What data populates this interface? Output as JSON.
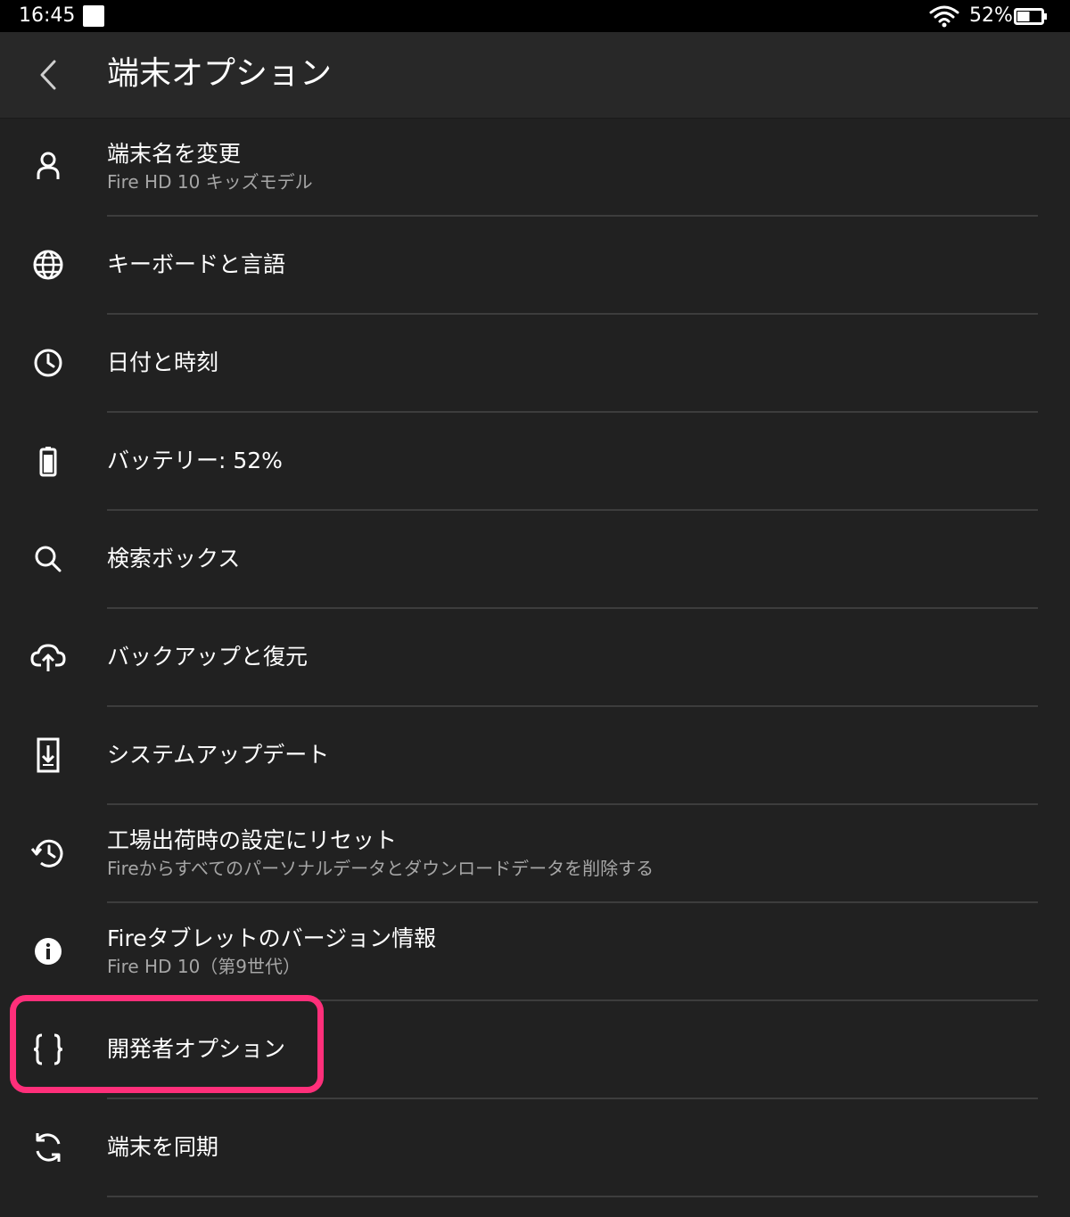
{
  "status_bar": {
    "time": "16:45",
    "notification_icon": "notification-square-icon",
    "wifi_icon": "wifi-icon",
    "battery_text": "52%",
    "battery_icon": "battery-icon",
    "battery_level": 0.52
  },
  "app_bar": {
    "back_icon": "chevron-left-icon",
    "title": "端末オプション"
  },
  "settings": [
    {
      "icon": "person-icon",
      "title": "端末名を変更",
      "subtitle": "Fire HD 10 キッズモデル"
    },
    {
      "icon": "globe-icon",
      "title": "キーボードと言語",
      "subtitle": ""
    },
    {
      "icon": "clock-icon",
      "title": "日付と時刻",
      "subtitle": ""
    },
    {
      "icon": "battery-icon",
      "title": "バッテリー: 52%",
      "subtitle": ""
    },
    {
      "icon": "search-icon",
      "title": "検索ボックス",
      "subtitle": ""
    },
    {
      "icon": "cloud-upload-icon",
      "title": "バックアップと復元",
      "subtitle": ""
    },
    {
      "icon": "system-update-icon",
      "title": "システムアップデート",
      "subtitle": ""
    },
    {
      "icon": "restore-icon",
      "title": "工場出荷時の設定にリセット",
      "subtitle": "Fireからすべてのパーソナルデータとダウンロードデータを削除する"
    },
    {
      "icon": "info-icon",
      "title": "Fireタブレットのバージョン情報",
      "subtitle": "Fire HD 10（第9世代）"
    },
    {
      "icon": "braces-icon",
      "title": "開発者オプション",
      "subtitle": ""
    },
    {
      "icon": "sync-icon",
      "title": "端末を同期",
      "subtitle": ""
    }
  ],
  "highlight": {
    "target": "開発者オプション",
    "color": "#ff2f7a"
  },
  "colors": {
    "background": "#212121",
    "app_bar": "#282828",
    "status_bar": "#000000",
    "divider": "#3d3d3d",
    "subtitle": "#a6a6a6"
  }
}
